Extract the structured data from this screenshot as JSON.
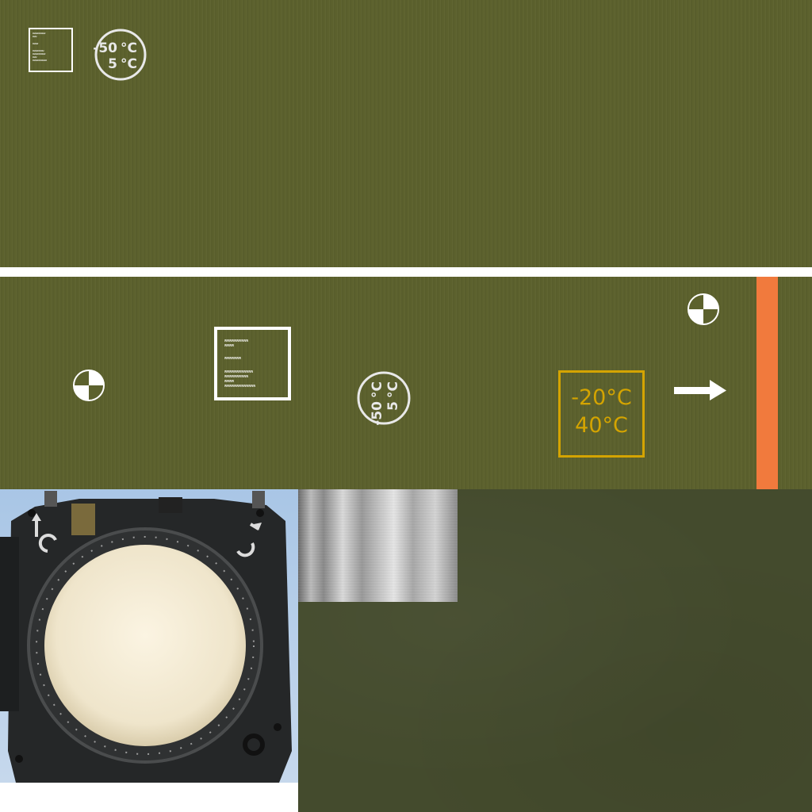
{
  "stencil_labels": {
    "small": {
      "lines_a": [
        "WWWWWWWWW",
        "WWW"
      ],
      "lines_b": [
        "WWWW"
      ],
      "lines_c": [
        "WWWWWWWW",
        "WWWWWWWWW",
        "WWW",
        "WWWWWWWWWW"
      ]
    },
    "large": {
      "lines_a": [
        "WWWWWWWWWW",
        "WWWW"
      ],
      "lines_b": [
        "WWWWWWW"
      ],
      "lines_c": [
        "WWWWWWWWWWWW",
        "WWWWWWWWWW",
        "WWWW",
        "WWWWWWWWWWWWW"
      ]
    }
  },
  "temperature_stamp": {
    "low": "-50",
    "low_unit": "°C",
    "high": "5",
    "high_unit": "°C"
  },
  "temperature_plate": {
    "line1": "-20°C",
    "line2": "40°C"
  },
  "colors": {
    "olive_paint": "#5c612d",
    "dark_olive": "#444b2d",
    "stencil_white": "#ffffff",
    "plate_yellow": "#d4a400",
    "orange_stripe": "#f17a3d"
  },
  "icons": [
    "balance-target-icon",
    "direction-arrow-icon",
    "lift-hook-icon"
  ]
}
